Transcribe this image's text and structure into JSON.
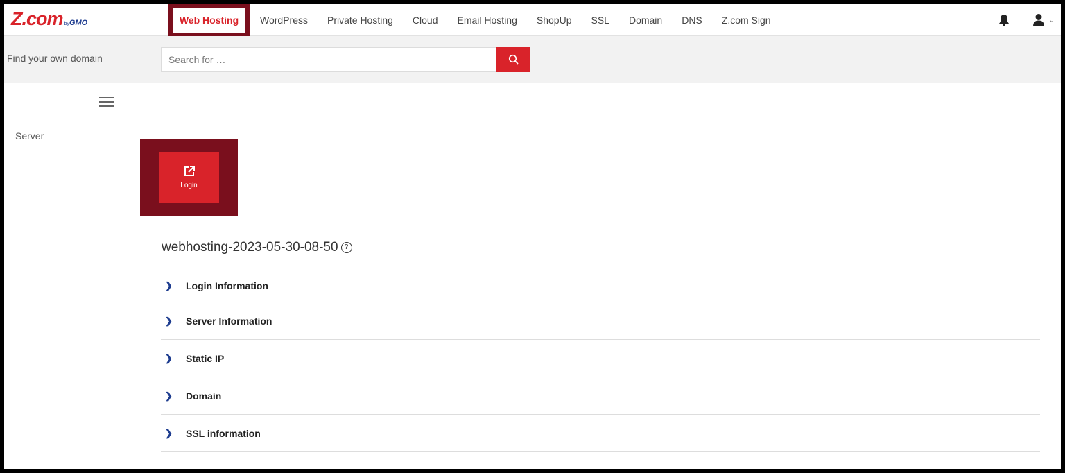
{
  "logo": {
    "main": "Z.com",
    "by": "by",
    "gmo": "GMO"
  },
  "nav": {
    "items": [
      {
        "label": "Web Hosting",
        "active": true
      },
      {
        "label": "WordPress"
      },
      {
        "label": "Private Hosting"
      },
      {
        "label": "Cloud"
      },
      {
        "label": "Email Hosting"
      },
      {
        "label": "ShopUp"
      },
      {
        "label": "SSL"
      },
      {
        "label": "Domain"
      },
      {
        "label": "DNS"
      },
      {
        "label": "Z.com Sign"
      }
    ]
  },
  "search": {
    "label": "Find your own domain",
    "placeholder": "Search for …"
  },
  "sidebar": {
    "items": [
      {
        "label": "Server"
      }
    ]
  },
  "main": {
    "login_label": "Login",
    "server_name": "webhosting-2023-05-30-08-50",
    "sections": [
      {
        "label": "Login Information"
      },
      {
        "label": "Server Information"
      },
      {
        "label": "Static IP"
      },
      {
        "label": "Domain"
      },
      {
        "label": "SSL information"
      }
    ]
  },
  "colors": {
    "brand_red": "#d9232a",
    "highlight": "#7a0f1d",
    "brand_blue": "#1d3c8f"
  }
}
